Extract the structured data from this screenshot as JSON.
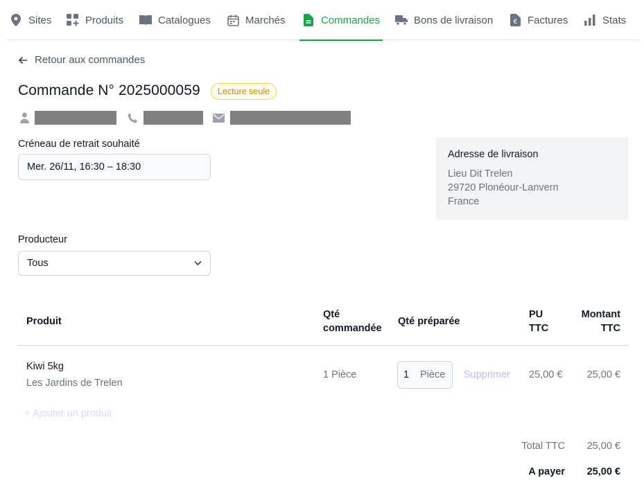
{
  "nav": {
    "items": [
      {
        "label": "Sites",
        "icon": "map-pin-icon"
      },
      {
        "label": "Produits",
        "icon": "grid-plus-icon"
      },
      {
        "label": "Catalogues",
        "icon": "book-open-icon"
      },
      {
        "label": "Marchés",
        "icon": "calendar-icon"
      },
      {
        "label": "Commandes",
        "icon": "document-icon",
        "active": true
      },
      {
        "label": "Bons de livraison",
        "icon": "truck-icon"
      },
      {
        "label": "Factures",
        "icon": "invoice-euro-icon"
      },
      {
        "label": "Stats",
        "icon": "bar-chart-icon"
      }
    ],
    "active_color": "#16a34a"
  },
  "back_label": "Retour aux commandes",
  "order": {
    "title": "Commande N° 2025000059",
    "badge": "Lecture seule"
  },
  "slot": {
    "label": "Créneau de retrait souhaité",
    "value": "Mer. 26/11, 16:30 – 18:30"
  },
  "address": {
    "heading": "Adresse de livraison",
    "line1": "Lieu Dit Trelen",
    "line2": "29720 Plonéour-Lanvern",
    "line3": "France"
  },
  "producer": {
    "label": "Producteur",
    "value": "Tous"
  },
  "table": {
    "headers": {
      "product": "Produit",
      "qty_ordered_1": "Qté",
      "qty_ordered_2": "commandée",
      "qty_prepared": "Qté préparée",
      "pu_1": "PU",
      "pu_2": "TTC",
      "amount_1": "Montant",
      "amount_2": "TTC"
    },
    "rows": [
      {
        "name": "Kiwi 5kg",
        "producer": "Les Jardins de Trelen",
        "qty_ordered": "1 Pièce",
        "qty_prepared": "1",
        "qty_unit": "Pièce",
        "delete": "Supprimer",
        "unit_price": "25,00 €",
        "amount": "25,00 €"
      }
    ],
    "add_product": "+ Ajouter un produit"
  },
  "totals": {
    "total_label": "Total TTC",
    "total_value": "25,00 €",
    "pay_label": "A payer",
    "pay_value": "25,00 €"
  }
}
